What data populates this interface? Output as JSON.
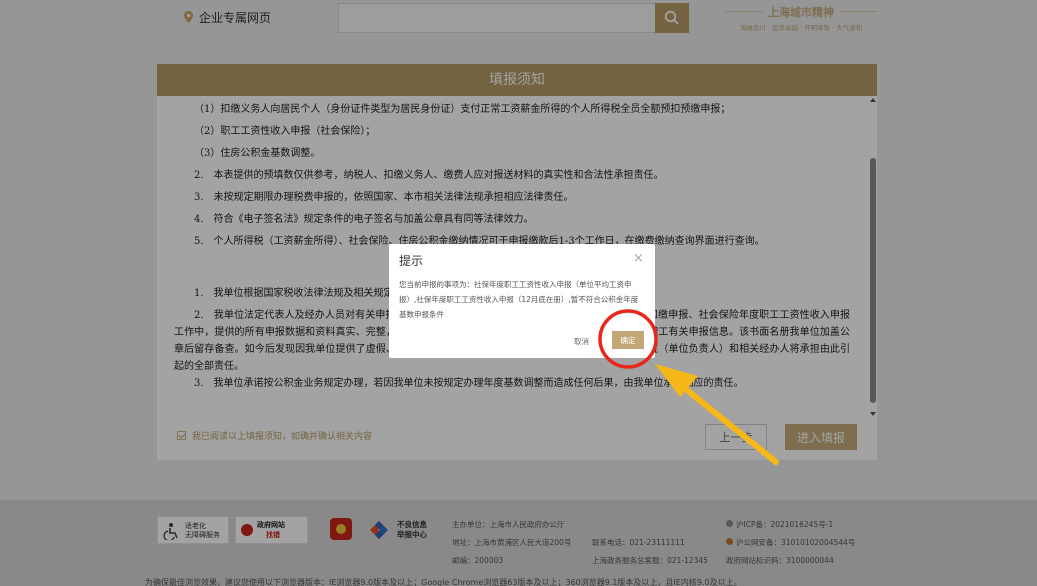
{
  "header": {
    "site_name": "企业专属网页",
    "search_placeholder": "",
    "brand_title": "上海城市精神",
    "brand_sub": "海纳百川 · 追求卓越 · 开明睿智 · 大气谦和"
  },
  "notice": {
    "title": "填报须知",
    "items": [
      "（1）扣缴义务人向居民个人（身份证件类型为居民身份证）支付正常工资薪金所得的个人所得税全员全额预扣预缴申报；",
      "（2）职工工资性收入申报（社会保险）；",
      "（3）住房公积金基数调整。",
      "2.　本表提供的预填数仅供参考，纳税人、扣缴义务人、缴费人应对报送材料的真实性和合法性承担责任。",
      "3.　未按规定期限办理税费申报的，依照国家、本市相关法律法规承担相应法律责任。",
      "4.　符合《电子签名法》规定条件的电子签名与加盖公章具有同等法律效力。",
      "5.　个人所得税（工资薪金所得）、社会保险、住房公积金缴纳情况可于申报缴款后1-3个工作日，在缴费缴纳查询界面进行查询。",
      "1.　我单位根据国家税收法律法规及相关规定",
      "2.　我单位法定代表人及经办人员对有关申报的真实性、准确性、完整性负责，本次办理的个人所得税扣缴申报、社会保险年度职工工资性收入申报工作中，提供的所有申报数据和资料真实、完整，录入相关申报系统的数据与申报表一致，并已告知本单位职工有关申报信息。该书面名册我单位加盖公章后留存备查。如今后发现因我单位提供了虚假、伪造的数据和资料，导致相关部门作出错误认定的，我单位（单位负责人）和相关经办人将承担由此引起的全部责任。",
      "3.　我单位承诺按公积金业务规定办理，若因我单位未按规定办理年度基数调整而造成任何后果，由我单位承担相应的责任。"
    ],
    "agree_text": "我已阅读以上填报须知，如确并确认相关内容",
    "prev_label": "上一步",
    "enter_label": "进入填报"
  },
  "footer": {
    "age_badge_line1": "适老化",
    "age_badge_line2": "无障碍服务",
    "site_badge_line1": "政府网站",
    "site_badge_line2": "找错",
    "report_line1": "不良信息",
    "report_line2": "举报中心",
    "host": "主办单位：上海市人民政府办公厅",
    "address": "地址：上海市黄浦区人民大道200号",
    "postcode": "邮编：200003",
    "phone": "联系电话：021-23111111",
    "hotline": "上海政务服务总客服：021-12345",
    "icp": "沪ICP备：2021016245号-1",
    "police": "沪公网安备：31010102004544号",
    "gov_code": "政府网站标识码：3100000044",
    "bottom_note": "为确保最佳浏览效果，建议您使用以下浏览器版本：IE浏览器9.0版本及以上；Google Chrome浏览器63版本及以上；360浏览器9.1版本及以上，且IE内核9.0及以上。"
  },
  "dialog": {
    "title": "提示",
    "close": "×",
    "message": "您当前申报的事项为：社保年度职工工资性收入申报（单位平均工资申报）,社保年度职工工资性收入申报（12月底在册）,暂不符合公积金年度基数申报条件",
    "cancel_label": "取消",
    "ok_label": "确定"
  },
  "colors": {
    "accent": "#b59b67",
    "annotation_circle": "#e8261c",
    "annotation_arrow": "#f6b818"
  }
}
